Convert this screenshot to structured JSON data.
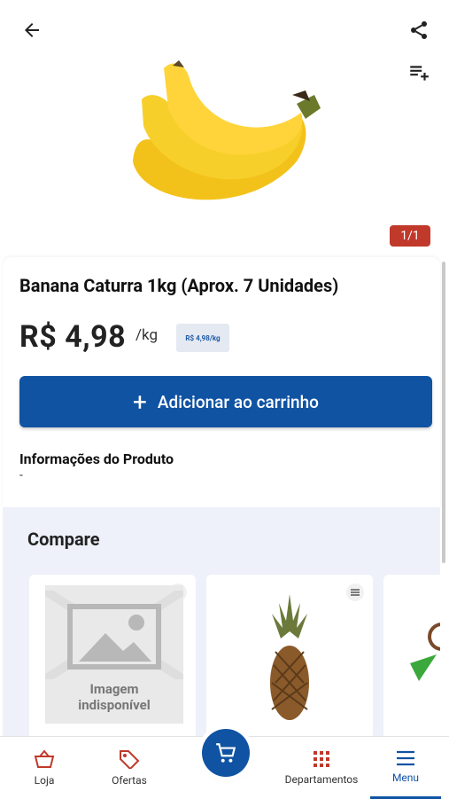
{
  "header": {
    "image_counter": "1/1"
  },
  "product": {
    "title": "Banana Caturra 1kg (Aprox. 7 Unidades)",
    "price": "R$ 4,98",
    "unit": "/kg",
    "unit_price_tag": "R$ 4,98/kg",
    "add_to_cart_label": "Adicionar ao carrinho",
    "info_title": "Informações do Produto",
    "info_value": "-"
  },
  "compare": {
    "title": "Compare",
    "placeholder_line1": "Imagem",
    "placeholder_line2": "indisponível"
  },
  "bottom_nav": {
    "items": [
      {
        "label": "Loja",
        "icon": "basket-icon"
      },
      {
        "label": "Ofertas",
        "icon": "tag-icon"
      },
      {
        "label": "Departamentos",
        "icon": "grid-icon"
      },
      {
        "label": "Menu",
        "icon": "hamburger-icon"
      }
    ],
    "active": "Menu"
  },
  "colors": {
    "primary": "#1053a3",
    "badge": "#c0392b",
    "nav_icon_red": "#c0392b"
  }
}
